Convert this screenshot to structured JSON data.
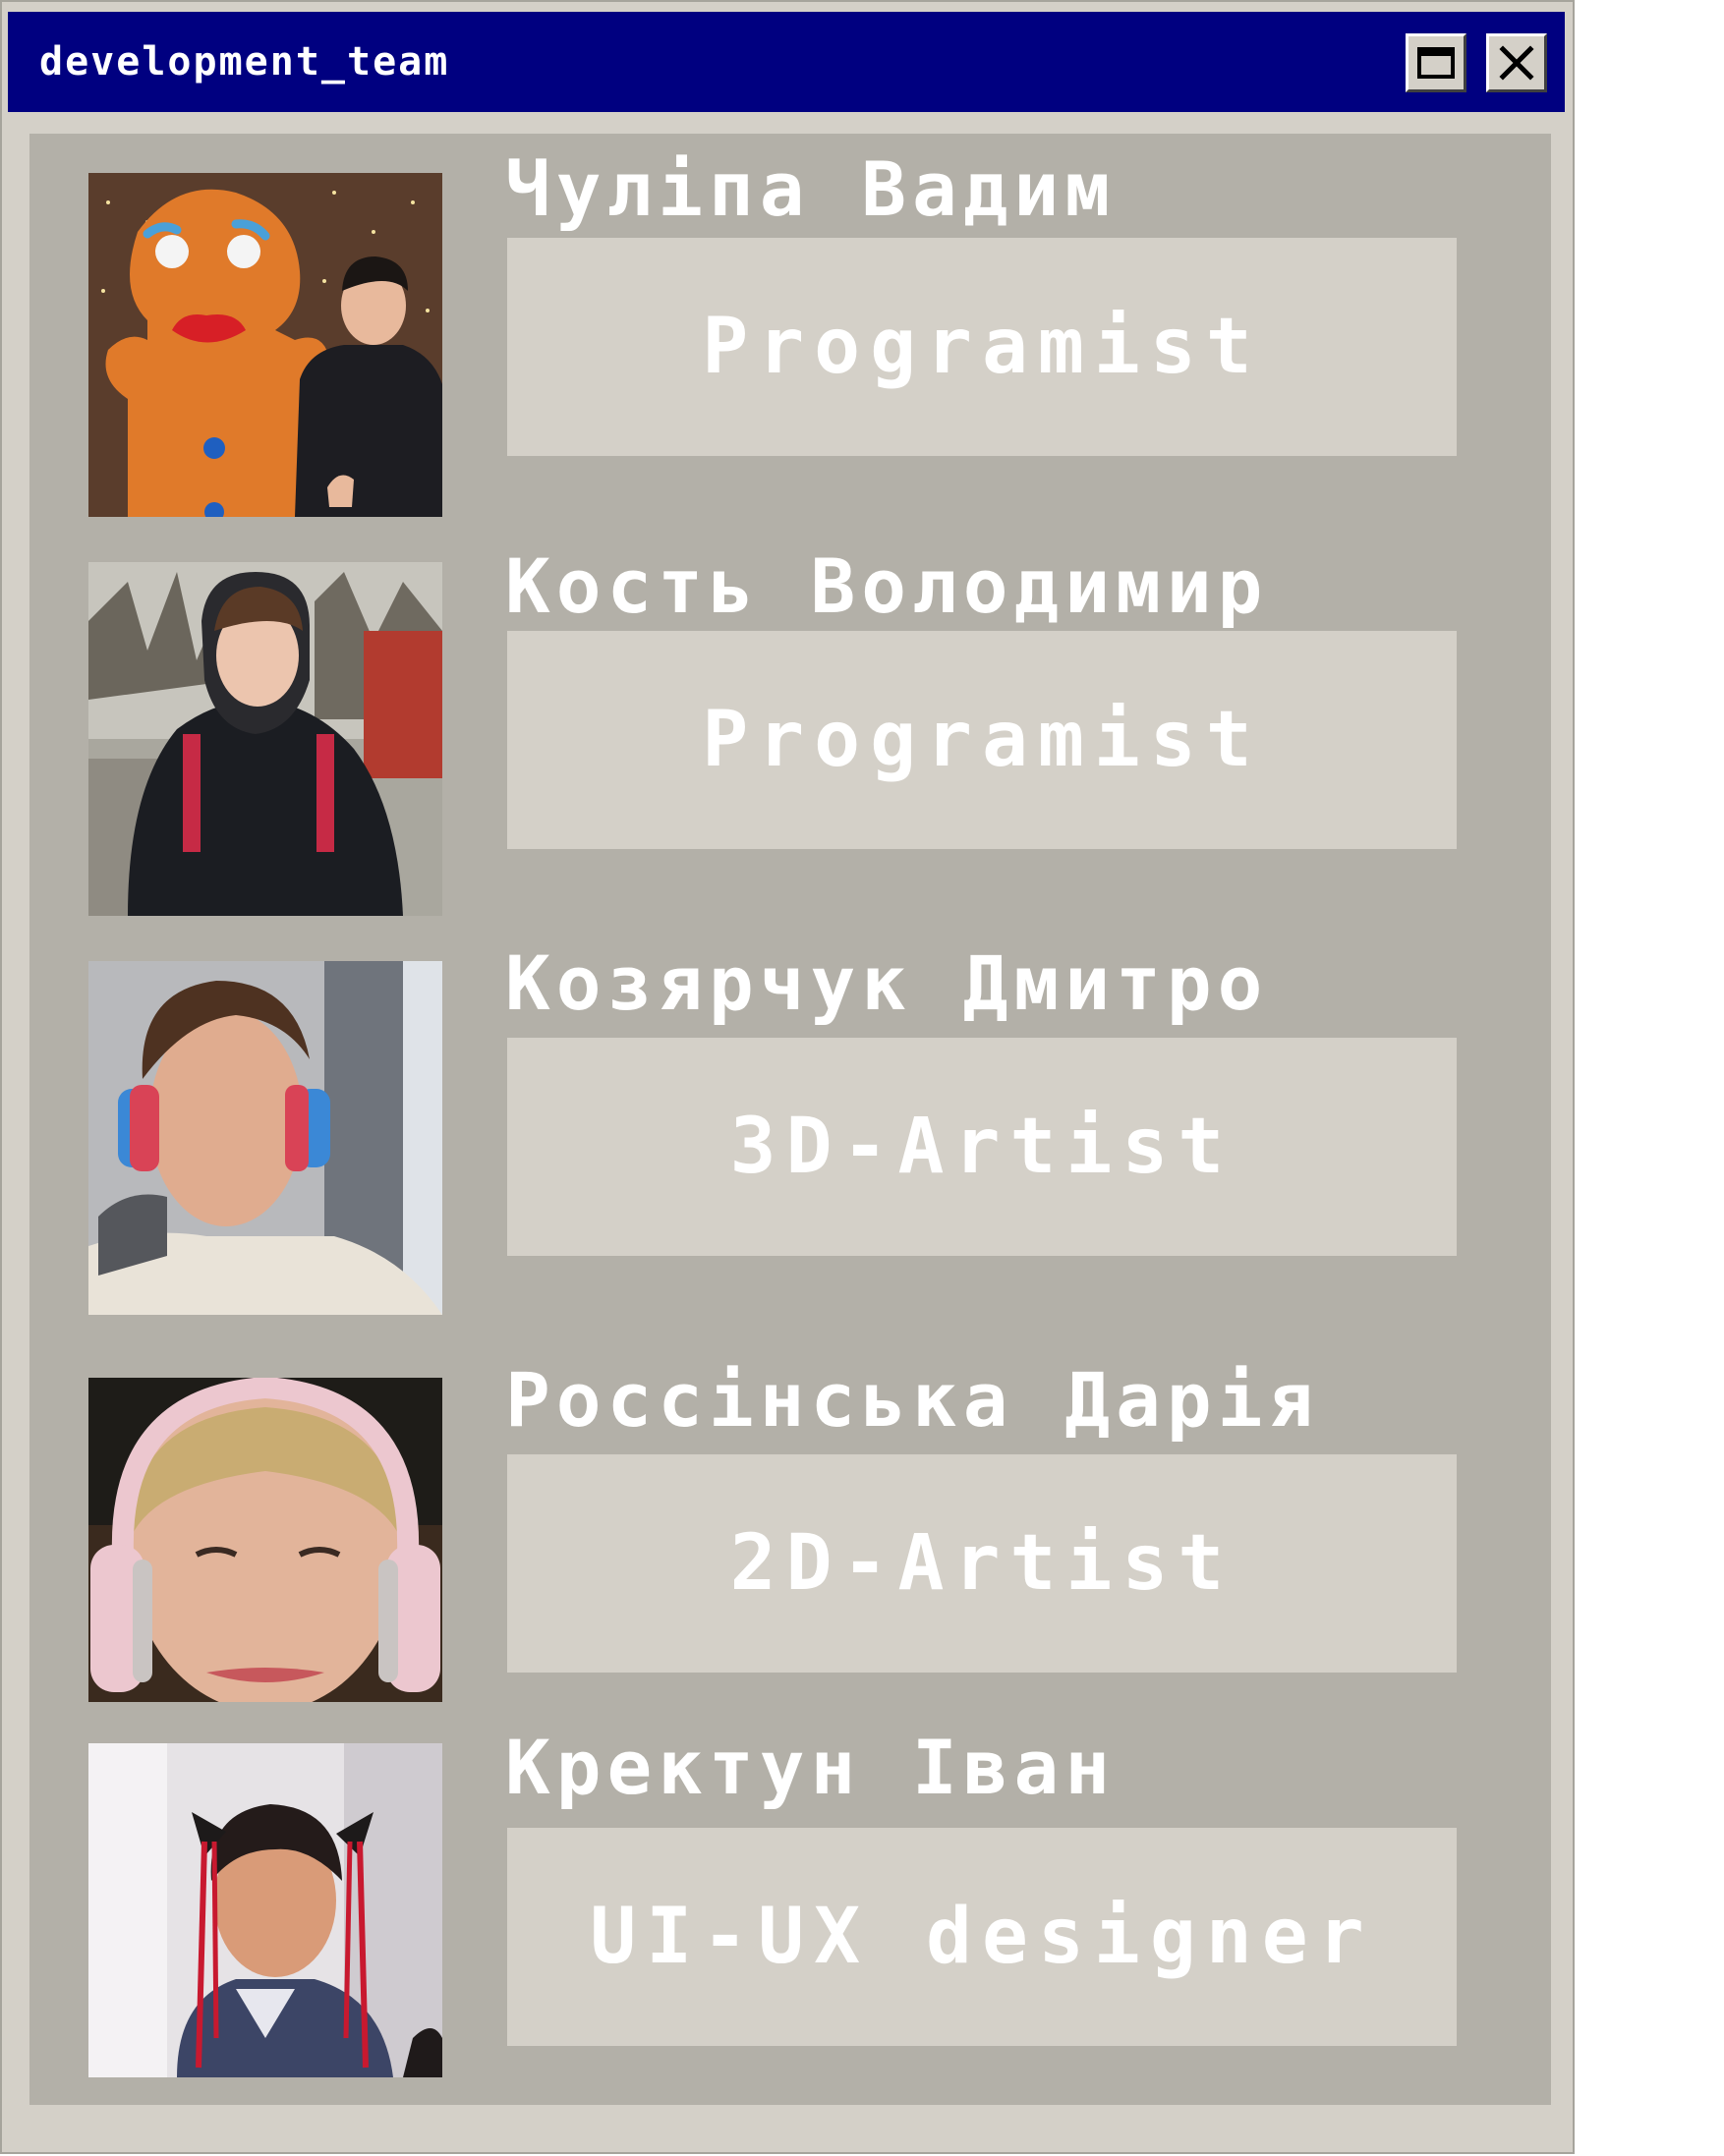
{
  "window": {
    "title": "development_team"
  },
  "colors": {
    "titlebar": "#000080",
    "window_bg": "#d4d0c8",
    "panel_bg": "#b3b0a8",
    "role_box_bg": "#d4d0c8",
    "text": "#ffffff"
  },
  "icons": {
    "maximize": "maximize-icon",
    "close": "close-icon"
  },
  "members": [
    {
      "name": "Чуліпа Вадим",
      "role": "Programist",
      "photo": "member-photo"
    },
    {
      "name": "Кость Володимир",
      "role": "Programist",
      "photo": "member-photo"
    },
    {
      "name": "Козярчук Дмитро",
      "role": "3D-Artist",
      "photo": "member-photo"
    },
    {
      "name": "Россінська Дарія",
      "role": "2D-Artist",
      "photo": "member-photo"
    },
    {
      "name": "Кректун Іван",
      "role": "UI-UX designer",
      "photo": "member-photo"
    }
  ]
}
